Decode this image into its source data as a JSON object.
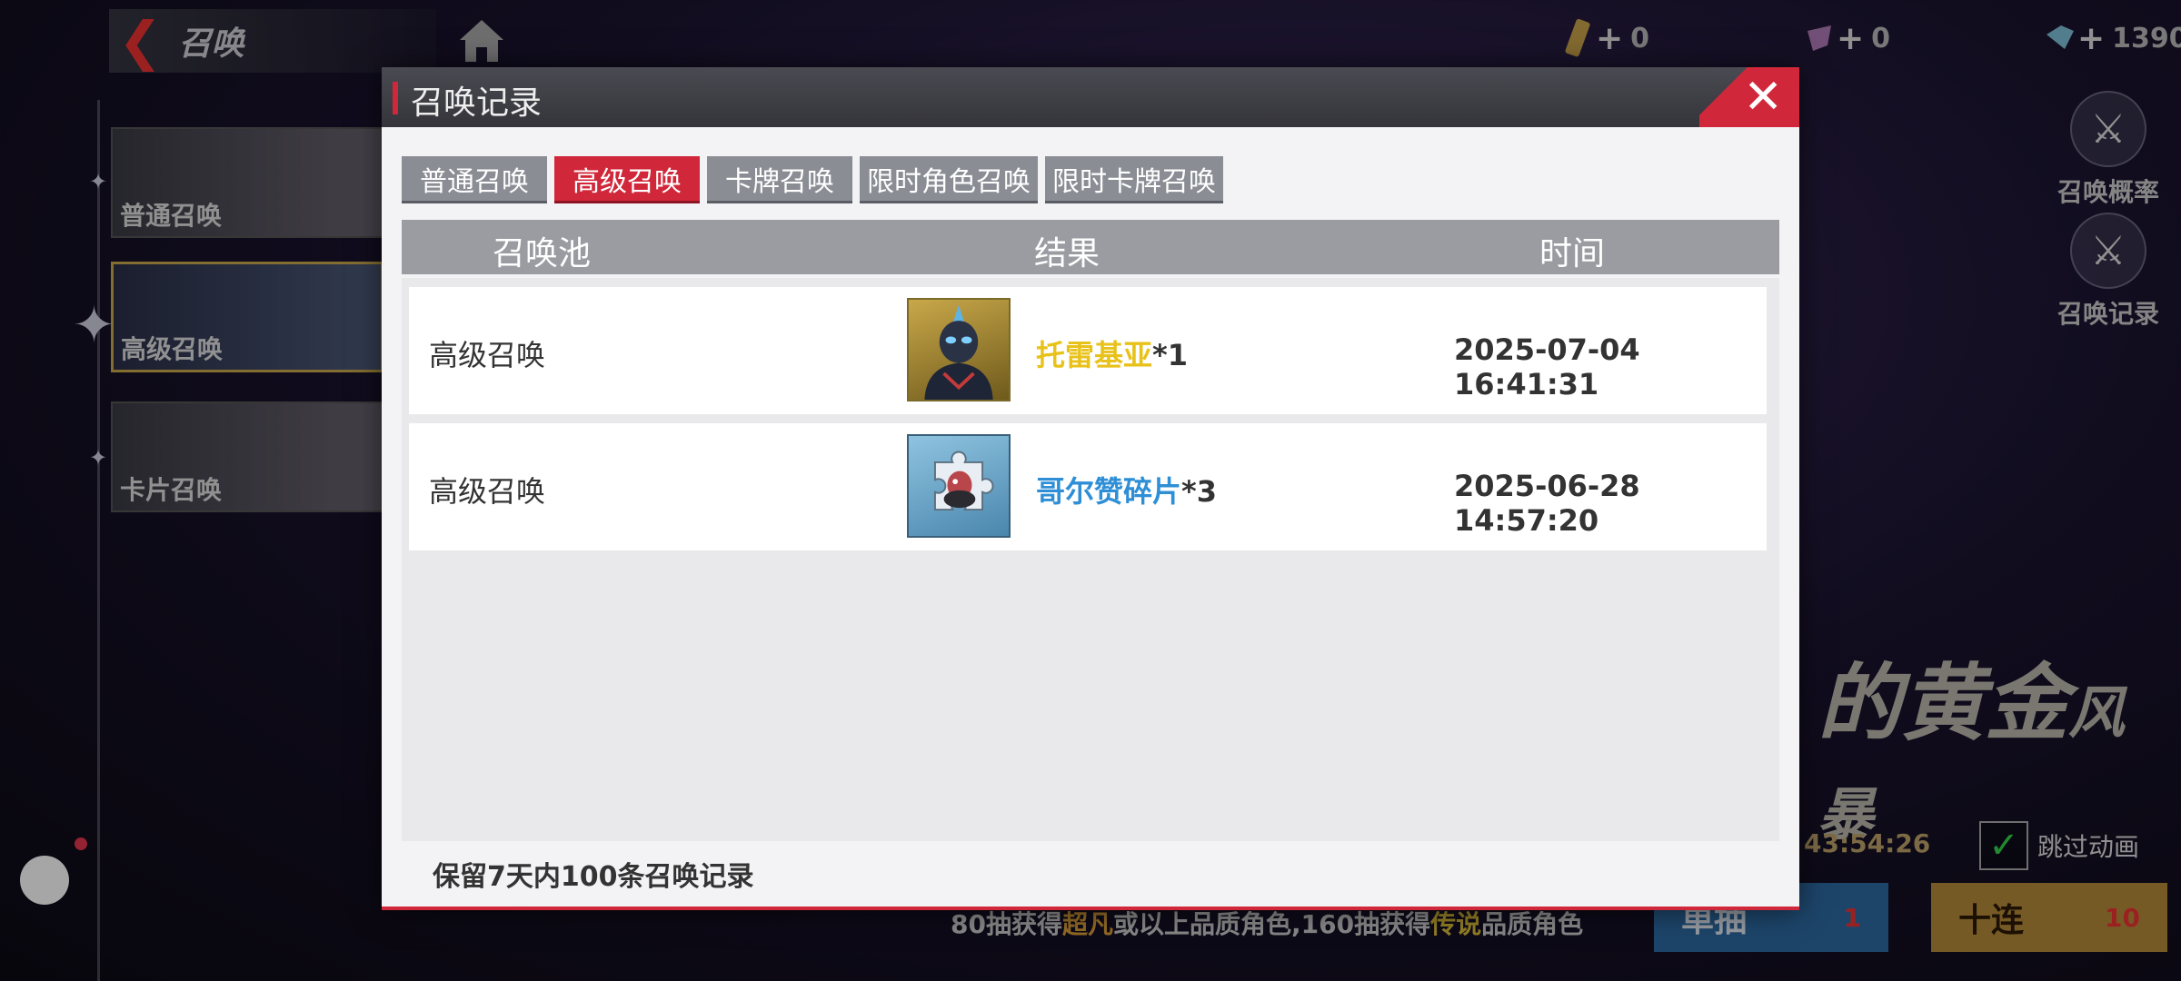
{
  "topbar": {
    "back_title": "召唤",
    "currencies": [
      {
        "icon": "ticket-icon",
        "amount": "0"
      },
      {
        "icon": "crystal-icon",
        "amount": "0"
      },
      {
        "icon": "diamond-icon",
        "amount": "1390"
      }
    ]
  },
  "side_cards": [
    {
      "label": "普通召唤"
    },
    {
      "label": "高级召唤"
    },
    {
      "label": "卡片召唤"
    }
  ],
  "right_buttons": {
    "rates": "召唤概率",
    "records": "召唤记录"
  },
  "banner": {
    "main": "黄金",
    "small": "风暴",
    "prefix": "的"
  },
  "timer": "43:54:26",
  "skip_label": "跳过动画",
  "pull": {
    "single": "单抽",
    "single_cost": "1",
    "ten": "十连",
    "ten_cost": "10"
  },
  "rate_text": {
    "p1": "80抽获得",
    "h1": "超凡",
    "p2": "或以上品质角色,160抽获得",
    "h2": "传说",
    "p3": "品质角色"
  },
  "modal": {
    "title": "召唤记录",
    "tabs": [
      "普通召唤",
      "高级召唤",
      "卡牌召唤",
      "限时角色召唤",
      "限时卡牌召唤"
    ],
    "active_tab": "高级召唤",
    "columns": [
      "召唤池",
      "结果",
      "时间"
    ],
    "rows": [
      {
        "pool": "高级召唤",
        "item": "托雷基亚",
        "qty": "*1",
        "time": "2025-07-04 16:41:31",
        "item_color": "#e8c21a"
      },
      {
        "pool": "高级召唤",
        "item": "哥尔赞碎片",
        "qty": "*3",
        "time": "2025-06-28 14:57:20",
        "item_color": "#2f8fd6"
      }
    ],
    "footer": "保留7天内100条召唤记录"
  },
  "colors": {
    "accent": "#d0283a",
    "gold": "#e8c21a",
    "blue": "#2f8fd6"
  }
}
